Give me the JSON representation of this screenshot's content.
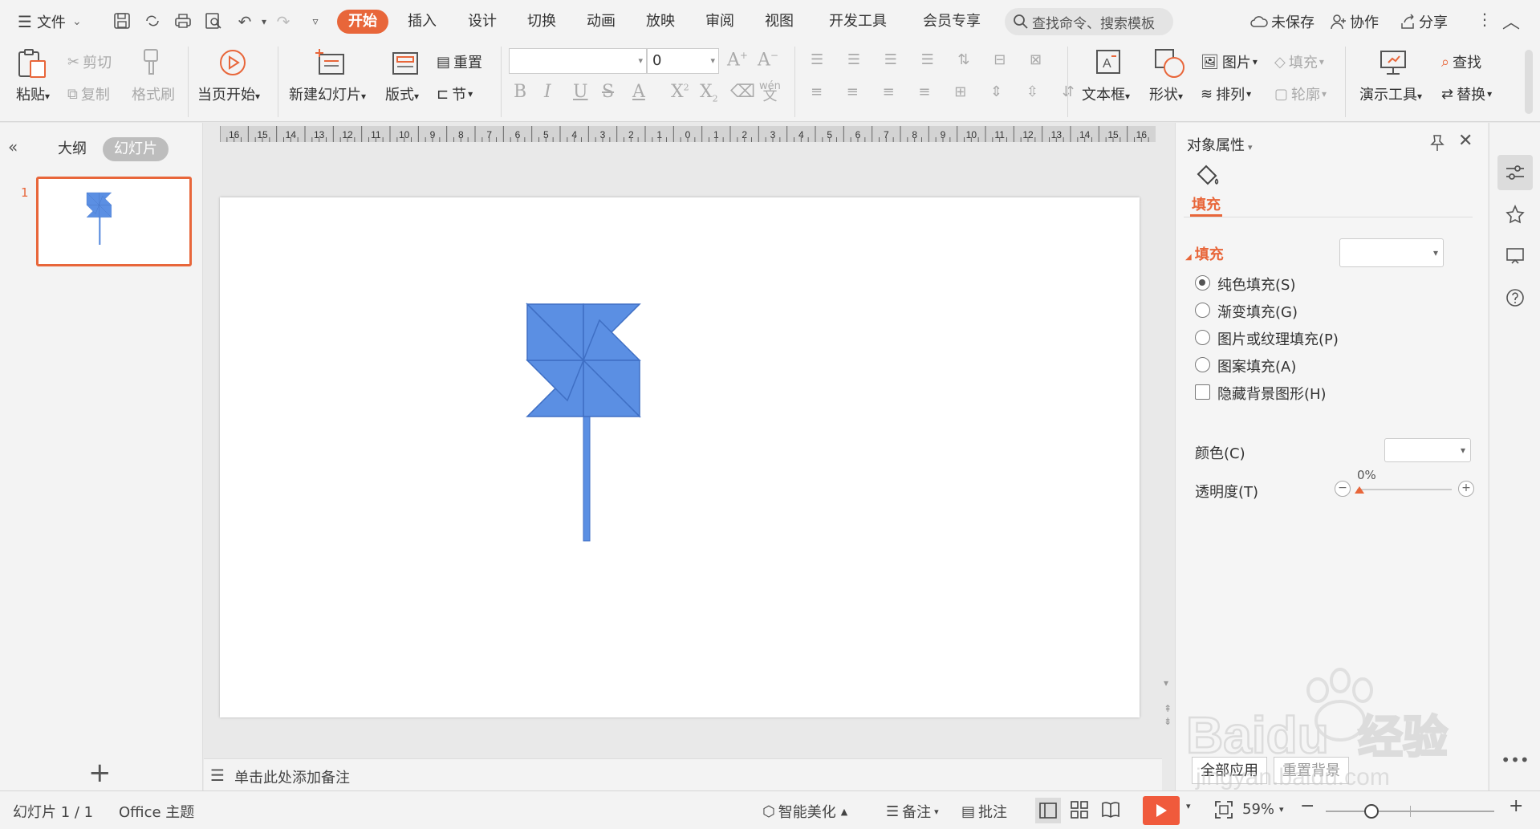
{
  "menu": {
    "file_label": "文件",
    "tabs": [
      "开始",
      "插入",
      "设计",
      "切换",
      "动画",
      "放映",
      "审阅",
      "视图",
      "开发工具",
      "会员专享"
    ],
    "active_tab": "开始",
    "search_placeholder": "查找命令、搜索模板",
    "unsaved_label": "未保存",
    "collab_label": "协作",
    "share_label": "分享"
  },
  "ribbon": {
    "paste": "粘贴",
    "cut": "剪切",
    "copy": "复制",
    "format_painter": "格式刷",
    "play_from_current": "当页开始",
    "new_slide": "新建幻灯片",
    "layout": "版式",
    "reset": "重置",
    "section": "节",
    "font_name": "",
    "font_size": "0",
    "textbox": "文本框",
    "shape": "形状",
    "picture": "图片",
    "fill": "填充",
    "arrange": "排列",
    "outline": "轮廓",
    "presentation_tools": "演示工具",
    "find": "查找",
    "replace": "替换",
    "pinyin_glyph": "wén"
  },
  "left_panel": {
    "tab_outline": "大纲",
    "tab_slides": "幻灯片",
    "slide_number": "1",
    "add_slide_glyph": "+"
  },
  "notes": {
    "placeholder": "单击此处添加备注"
  },
  "ruler": {
    "labels": [
      "16",
      "15",
      "14",
      "13",
      "12",
      "11",
      "10",
      "9",
      "8",
      "7",
      "6",
      "5",
      "4",
      "3",
      "2",
      "1",
      "0",
      "1",
      "2",
      "3",
      "4",
      "5",
      "6",
      "7",
      "8",
      "9",
      "10",
      "11",
      "12",
      "13",
      "14",
      "15",
      "16"
    ]
  },
  "slide": {
    "shape": "pinwheel",
    "fill_color": "#5b8fe3",
    "stroke_color": "#3f6fc4"
  },
  "right_panel": {
    "title": "对象属性",
    "tab_fill": "填充",
    "section_fill": "填充",
    "options": [
      "纯色填充(S)",
      "渐变填充(G)",
      "图片或纹理填充(P)",
      "图案填充(A)"
    ],
    "selected_option": "纯色填充(S)",
    "hide_bg": "隐藏背景图形(H)",
    "color_label": "颜色(C)",
    "transparency_label": "透明度(T)",
    "transparency_value": "0%",
    "apply_all": "全部应用",
    "reset_bg": "重置背景"
  },
  "status": {
    "slide_info": "幻灯片 1 / 1",
    "theme": "Office 主题",
    "beautify": "智能美化",
    "notes": "备注",
    "comments": "批注",
    "zoom": "59%"
  },
  "watermark": {
    "brand": "Baidu",
    "product": "经验",
    "url": "jingyan.baidu.com"
  },
  "colors": {
    "accent": "#e8663a",
    "slide_shape": "#5b8fe3",
    "play_button": "#f05a3c"
  }
}
